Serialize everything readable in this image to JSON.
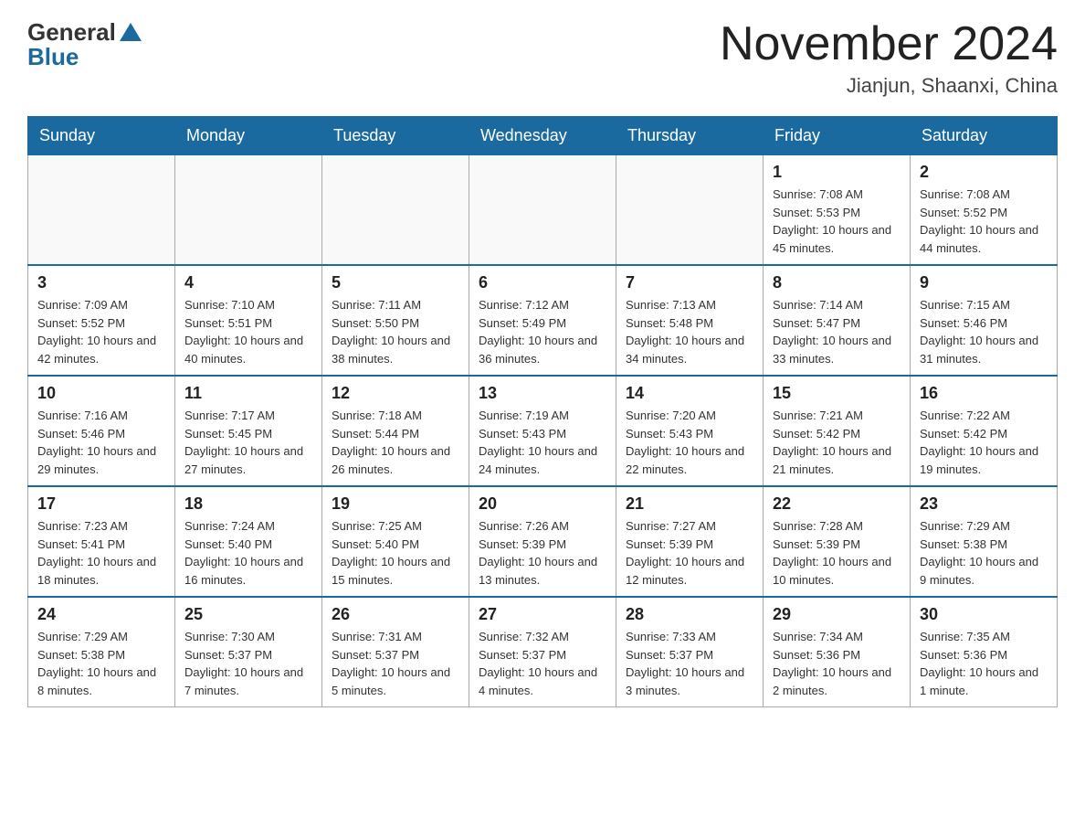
{
  "header": {
    "logo_general": "General",
    "logo_blue": "Blue",
    "month_title": "November 2024",
    "location": "Jianjun, Shaanxi, China"
  },
  "weekdays": [
    "Sunday",
    "Monday",
    "Tuesday",
    "Wednesday",
    "Thursday",
    "Friday",
    "Saturday"
  ],
  "weeks": [
    [
      {
        "day": "",
        "info": ""
      },
      {
        "day": "",
        "info": ""
      },
      {
        "day": "",
        "info": ""
      },
      {
        "day": "",
        "info": ""
      },
      {
        "day": "",
        "info": ""
      },
      {
        "day": "1",
        "info": "Sunrise: 7:08 AM\nSunset: 5:53 PM\nDaylight: 10 hours and 45 minutes."
      },
      {
        "day": "2",
        "info": "Sunrise: 7:08 AM\nSunset: 5:52 PM\nDaylight: 10 hours and 44 minutes."
      }
    ],
    [
      {
        "day": "3",
        "info": "Sunrise: 7:09 AM\nSunset: 5:52 PM\nDaylight: 10 hours and 42 minutes."
      },
      {
        "day": "4",
        "info": "Sunrise: 7:10 AM\nSunset: 5:51 PM\nDaylight: 10 hours and 40 minutes."
      },
      {
        "day": "5",
        "info": "Sunrise: 7:11 AM\nSunset: 5:50 PM\nDaylight: 10 hours and 38 minutes."
      },
      {
        "day": "6",
        "info": "Sunrise: 7:12 AM\nSunset: 5:49 PM\nDaylight: 10 hours and 36 minutes."
      },
      {
        "day": "7",
        "info": "Sunrise: 7:13 AM\nSunset: 5:48 PM\nDaylight: 10 hours and 34 minutes."
      },
      {
        "day": "8",
        "info": "Sunrise: 7:14 AM\nSunset: 5:47 PM\nDaylight: 10 hours and 33 minutes."
      },
      {
        "day": "9",
        "info": "Sunrise: 7:15 AM\nSunset: 5:46 PM\nDaylight: 10 hours and 31 minutes."
      }
    ],
    [
      {
        "day": "10",
        "info": "Sunrise: 7:16 AM\nSunset: 5:46 PM\nDaylight: 10 hours and 29 minutes."
      },
      {
        "day": "11",
        "info": "Sunrise: 7:17 AM\nSunset: 5:45 PM\nDaylight: 10 hours and 27 minutes."
      },
      {
        "day": "12",
        "info": "Sunrise: 7:18 AM\nSunset: 5:44 PM\nDaylight: 10 hours and 26 minutes."
      },
      {
        "day": "13",
        "info": "Sunrise: 7:19 AM\nSunset: 5:43 PM\nDaylight: 10 hours and 24 minutes."
      },
      {
        "day": "14",
        "info": "Sunrise: 7:20 AM\nSunset: 5:43 PM\nDaylight: 10 hours and 22 minutes."
      },
      {
        "day": "15",
        "info": "Sunrise: 7:21 AM\nSunset: 5:42 PM\nDaylight: 10 hours and 21 minutes."
      },
      {
        "day": "16",
        "info": "Sunrise: 7:22 AM\nSunset: 5:42 PM\nDaylight: 10 hours and 19 minutes."
      }
    ],
    [
      {
        "day": "17",
        "info": "Sunrise: 7:23 AM\nSunset: 5:41 PM\nDaylight: 10 hours and 18 minutes."
      },
      {
        "day": "18",
        "info": "Sunrise: 7:24 AM\nSunset: 5:40 PM\nDaylight: 10 hours and 16 minutes."
      },
      {
        "day": "19",
        "info": "Sunrise: 7:25 AM\nSunset: 5:40 PM\nDaylight: 10 hours and 15 minutes."
      },
      {
        "day": "20",
        "info": "Sunrise: 7:26 AM\nSunset: 5:39 PM\nDaylight: 10 hours and 13 minutes."
      },
      {
        "day": "21",
        "info": "Sunrise: 7:27 AM\nSunset: 5:39 PM\nDaylight: 10 hours and 12 minutes."
      },
      {
        "day": "22",
        "info": "Sunrise: 7:28 AM\nSunset: 5:39 PM\nDaylight: 10 hours and 10 minutes."
      },
      {
        "day": "23",
        "info": "Sunrise: 7:29 AM\nSunset: 5:38 PM\nDaylight: 10 hours and 9 minutes."
      }
    ],
    [
      {
        "day": "24",
        "info": "Sunrise: 7:29 AM\nSunset: 5:38 PM\nDaylight: 10 hours and 8 minutes."
      },
      {
        "day": "25",
        "info": "Sunrise: 7:30 AM\nSunset: 5:37 PM\nDaylight: 10 hours and 7 minutes."
      },
      {
        "day": "26",
        "info": "Sunrise: 7:31 AM\nSunset: 5:37 PM\nDaylight: 10 hours and 5 minutes."
      },
      {
        "day": "27",
        "info": "Sunrise: 7:32 AM\nSunset: 5:37 PM\nDaylight: 10 hours and 4 minutes."
      },
      {
        "day": "28",
        "info": "Sunrise: 7:33 AM\nSunset: 5:37 PM\nDaylight: 10 hours and 3 minutes."
      },
      {
        "day": "29",
        "info": "Sunrise: 7:34 AM\nSunset: 5:36 PM\nDaylight: 10 hours and 2 minutes."
      },
      {
        "day": "30",
        "info": "Sunrise: 7:35 AM\nSunset: 5:36 PM\nDaylight: 10 hours and 1 minute."
      }
    ]
  ]
}
